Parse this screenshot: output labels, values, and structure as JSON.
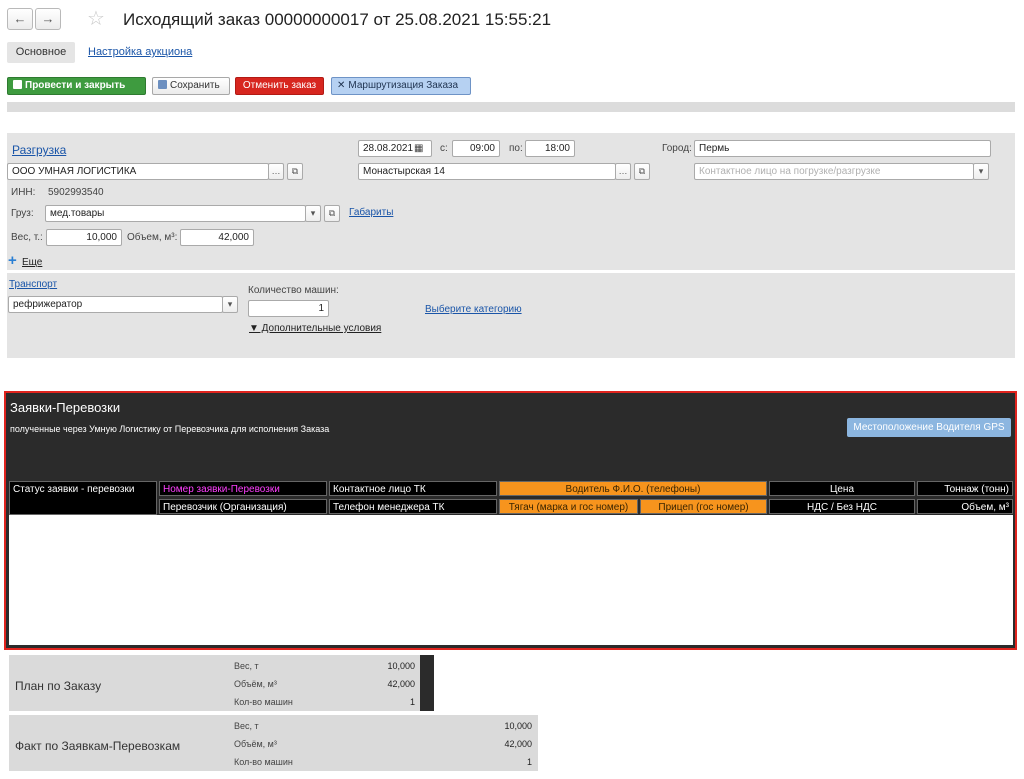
{
  "window": {
    "title": "Исходящий заказ 00000000017 от 25.08.2021 15:55:21",
    "back_icon": "←",
    "forward_icon": "→",
    "star_icon": "☆"
  },
  "tabs": [
    {
      "label": "Основное"
    },
    {
      "label": "Настройка аукциона"
    }
  ],
  "toolbar": {
    "post_close": "Провести и закрыть",
    "save": "Сохранить",
    "cancel_order": "Отменить заказ",
    "routing": "Маршрутизация Заказа"
  },
  "unload": {
    "heading": "Разгрузка",
    "date": "28.08.2021",
    "time_from_label": "с:",
    "time_from": "09:00",
    "time_to_label": "по:",
    "time_to": "18:00",
    "city_label": "Город:",
    "city": "Пермь",
    "company": "ООО УМНАЯ ЛОГИСТИКА",
    "address": "Монастырская 14",
    "contact_placeholder": "Контактное лицо на погрузке/разгрузке",
    "inn_label": "ИНН:",
    "inn": "5902993540",
    "cargo_label": "Груз:",
    "cargo": "мед.товары",
    "dimensions_link": "Габариты",
    "weight_label": "Вес, т.:",
    "weight": "10,000",
    "volume_label": "Объем, м³:",
    "volume": "42,000",
    "more": "Еще"
  },
  "transport": {
    "link": "Транспорт",
    "type": "рефрижератор",
    "cars_label": "Количество машин:",
    "cars": "1",
    "category_link": "Выберите категорию",
    "extra_conditions": "▼ Дополнительные условия"
  },
  "requests": {
    "title": "Заявки-Перевозки",
    "subtitle": "полученные через Умную Логистику от Перевозчика для исполнения Заказа",
    "gps_button": "Местоположение Водителя GPS",
    "header_row1": {
      "status": "Статус заявки - перевозки",
      "number": "Номер заявки-Перевозки",
      "contact": "Контактное лицо ТК",
      "driver": "Водитель Ф.И.О. (телефоны)",
      "price": "Цена",
      "tonnage": "Тоннаж (тонн)"
    },
    "header_row2": {
      "carrier": "Перевозчик (Организация)",
      "manager_phone": "Телефон менеджера ТК",
      "tractor": "Тягач (марка и гос номер)",
      "trailer": "Прицеп (гос номер)",
      "vat": "НДС / Без НДС",
      "volume": "Объем, м³"
    },
    "colors": {
      "orange": "#f7941d",
      "magenta": "#ff3fff",
      "border": "#e0241e"
    }
  },
  "plan": {
    "title": "План по Заказу",
    "weight_label": "Вес, т",
    "weight": "10,000",
    "volume_label": "Объём, м³",
    "volume": "42,000",
    "cars_label": "Кол-во машин",
    "cars": "1"
  },
  "fact": {
    "title": "Факт по Заявкам-Перевозкам",
    "weight_label": "Вес, т",
    "weight": "10,000",
    "volume_label": "Объём, м³",
    "volume": "42,000",
    "cars_label": "Кол-во машин",
    "cars": "1"
  }
}
